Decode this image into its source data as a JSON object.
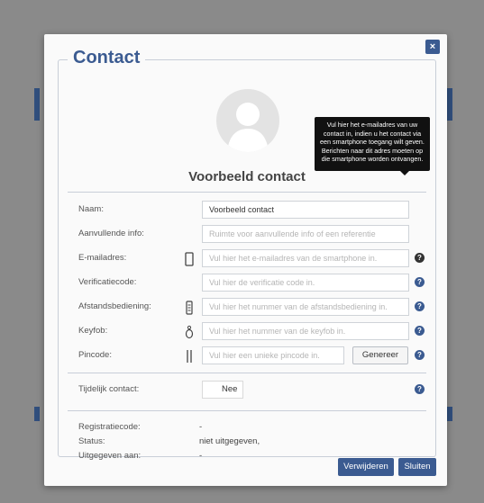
{
  "dialog": {
    "title": "Contact",
    "close_label": "×",
    "contact_name": "Voorbeeld contact"
  },
  "fields": {
    "naam": {
      "label": "Naam:",
      "value": "Voorbeeld contact"
    },
    "aanvullende_info": {
      "label": "Aanvullende info:",
      "placeholder": "Ruimte voor aanvullende info of een referentie"
    },
    "emailadres": {
      "label": "E-mailadres:",
      "placeholder": "Vul hier het e-mailadres van de smartphone in.",
      "icon": "smartphone-icon",
      "help": "?"
    },
    "verificatiecode": {
      "label": "Verificatiecode:",
      "placeholder": "Vul hier de verificatie code in.",
      "help": "?"
    },
    "afstandsbediening": {
      "label": "Afstandsbediening:",
      "placeholder": "Vul hier het nummer van de afstandsbediening in.",
      "icon": "remote-icon",
      "help": "?"
    },
    "keyfob": {
      "label": "Keyfob:",
      "placeholder": "Vul hier het nummer van de keyfob in.",
      "icon": "keyfob-icon",
      "help": "?"
    },
    "pincode": {
      "label": "Pincode:",
      "placeholder": "Vul hier een unieke pincode in.",
      "icon": "keypad-icon",
      "button": "Genereer",
      "help": "?"
    },
    "tijdelijk_contact": {
      "label": "Tijdelijk contact:",
      "toggle": "Nee",
      "help": "?"
    }
  },
  "info": {
    "registratiecode": {
      "label": "Registratiecode:",
      "value": "-"
    },
    "status": {
      "label": "Status:",
      "value": "niet uitgegeven,"
    },
    "uitgegeven_aan": {
      "label": "Uitgegeven aan:",
      "value": "-"
    }
  },
  "tooltip": {
    "text": "Vul hier het e-mailadres van uw contact in, indien u het contact via een smartphone toegang wilt geven. Berichten naar dit adres moeten op die smartphone worden ontvangen."
  },
  "footer": {
    "delete_label": "Verwijderen",
    "close_label": "Sluiten"
  },
  "colors": {
    "accent": "#3b5b91",
    "overlay": "#8a8a8a"
  }
}
